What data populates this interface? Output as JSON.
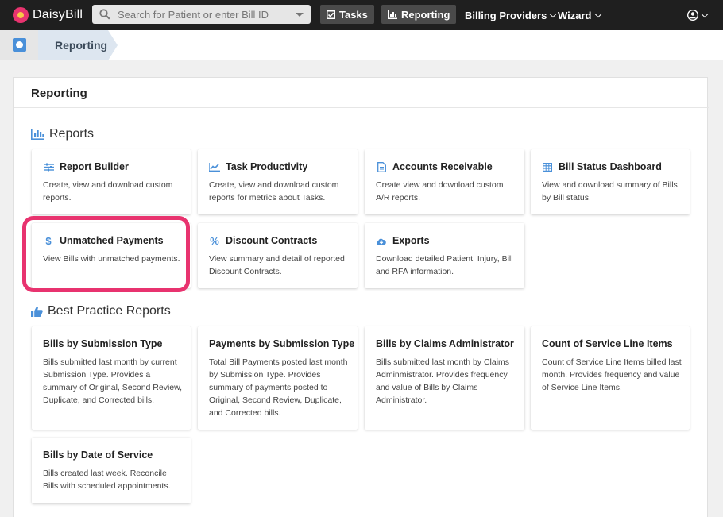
{
  "app": {
    "name": "DaisyBill"
  },
  "navbar": {
    "search_placeholder": "Search for Patient or enter Bill ID",
    "tasks_label": "Tasks",
    "reporting_label": "Reporting",
    "billing_providers_label": "Billing Providers",
    "wizard_label": "Wizard"
  },
  "breadcrumb": {
    "current": "Reporting"
  },
  "panel": {
    "title": "Reporting"
  },
  "reports": {
    "title": "Reports",
    "cards": [
      {
        "title": "Report Builder",
        "icon": "sliders-icon",
        "desc": "Create, view and download custom reports."
      },
      {
        "title": "Task Productivity",
        "icon": "line-chart-icon",
        "desc": "Create, view and download custom reports for metrics about Tasks."
      },
      {
        "title": "Accounts Receivable",
        "icon": "document-icon",
        "desc": "Create view and download custom A/R reports."
      },
      {
        "title": "Bill Status Dashboard",
        "icon": "table-icon",
        "desc": "View and download summary of Bills by Bill status."
      },
      {
        "title": "Unmatched Payments",
        "icon": "dollar-icon",
        "desc": "View Bills with unmatched payments."
      },
      {
        "title": "Discount Contracts",
        "icon": "percent-icon",
        "desc": "View summary and detail of reported Discount Contracts."
      },
      {
        "title": "Exports",
        "icon": "cloud-download-icon",
        "desc": "Download detailed Patient, Injury, Bill and RFA information."
      }
    ]
  },
  "best_practice": {
    "title": "Best Practice Reports",
    "cards": [
      {
        "title": "Bills by Submission Type",
        "desc": "Bills submitted last month by current Submission Type. Provides a summary of Original, Second Review, Duplicate, and Corrected bills."
      },
      {
        "title": "Payments by Submission Type",
        "desc": "Total Bill Payments posted last month by Submission Type. Provides summary of payments posted to Original, Second Review, Duplicate, and Corrected bills."
      },
      {
        "title": "Bills by Claims Administrator",
        "desc": "Bills submitted last month by Claims Adminmistrator. Provides frequency and value of Bills by Claims Administrator."
      },
      {
        "title": "Count of Service Line Items",
        "desc": "Count of Service Line Items billed last month. Provides frequency and value of Service Line Items."
      },
      {
        "title": "Bills by Date of Service",
        "desc": "Bills created last week. Reconcile Bills with scheduled appointments."
      }
    ]
  },
  "colors": {
    "accent": "#4a90d9",
    "highlight": "#e8336f",
    "navbar": "#1f1f1f"
  }
}
